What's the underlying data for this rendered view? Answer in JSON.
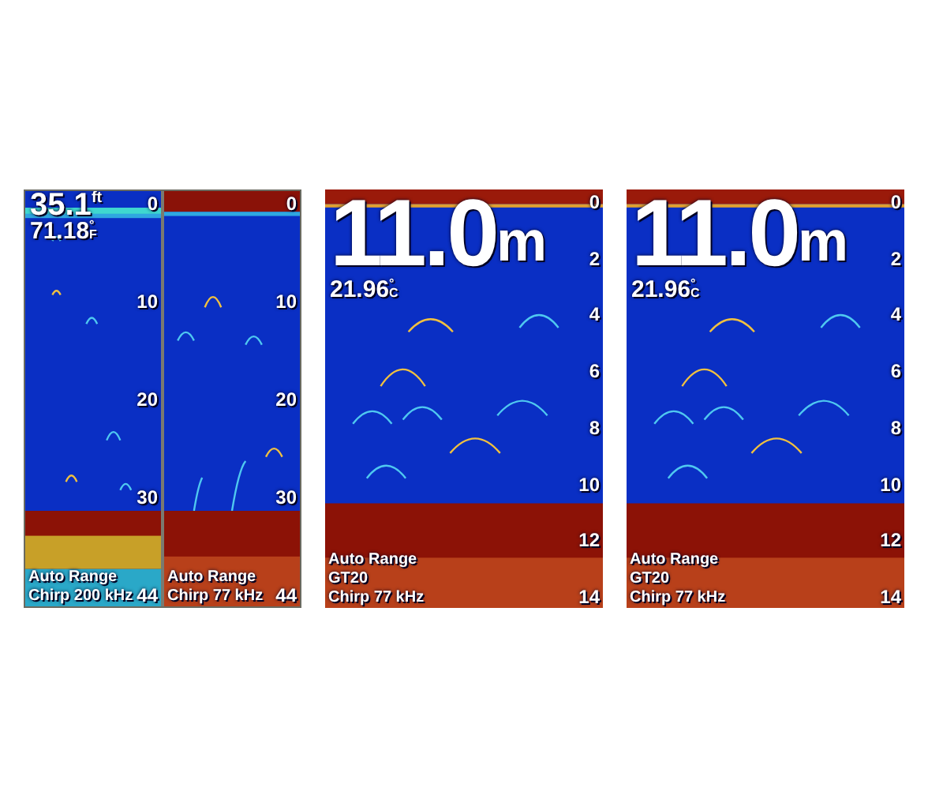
{
  "screens": [
    {
      "panes": [
        {
          "depth": {
            "value": "35.1",
            "unit": "ft"
          },
          "temperature": {
            "value": "71.18",
            "unit": "°F"
          },
          "scale": [
            "0",
            "10",
            "20",
            "30",
            "44"
          ],
          "info": [
            "Auto Range",
            "Chirp 200 kHz"
          ]
        },
        {
          "scale": [
            "0",
            "10",
            "20",
            "30",
            "44"
          ],
          "info": [
            "Auto Range",
            "Chirp 77 kHz"
          ]
        }
      ]
    },
    {
      "panes": [
        {
          "depth": {
            "value": "11.0",
            "unit": "m"
          },
          "temperature": {
            "value": "21.96",
            "unit": "°C"
          },
          "scale": [
            "0",
            "2",
            "4",
            "6",
            "8",
            "10",
            "12",
            "14"
          ],
          "info": [
            "Auto Range",
            "GT20",
            "Chirp 77 kHz"
          ]
        }
      ]
    },
    {
      "panes": [
        {
          "depth": {
            "value": "11.0",
            "unit": "m"
          },
          "temperature": {
            "value": "21.96",
            "unit": "°C"
          },
          "scale": [
            "0",
            "2",
            "4",
            "6",
            "8",
            "10",
            "12",
            "14"
          ],
          "info": [
            "Auto Range",
            "GT20",
            "Chirp 77 kHz"
          ]
        }
      ]
    }
  ]
}
